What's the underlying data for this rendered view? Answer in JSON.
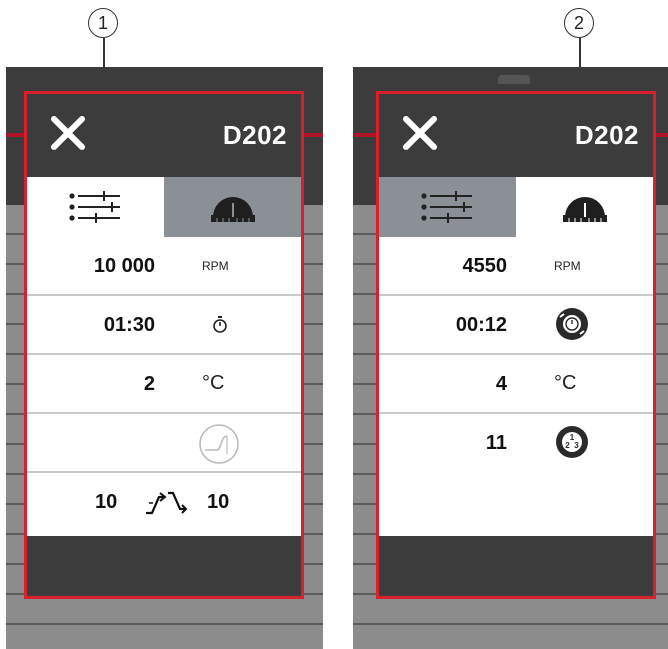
{
  "panels": [
    {
      "callout": "1",
      "title": "D202",
      "active_tab": "settings",
      "rows": [
        {
          "value": "10 000",
          "unit": "RPM"
        },
        {
          "value": "01:30",
          "unit": "timer-icon"
        },
        {
          "value": "2",
          "unit": "°C"
        },
        {
          "value": "",
          "unit": "curve-icon"
        },
        {
          "accel": "10",
          "decel": "10"
        }
      ]
    },
    {
      "callout": "2",
      "title": "D202",
      "active_tab": "status",
      "rows": [
        {
          "value": "4550",
          "unit": "RPM"
        },
        {
          "value": "00:12",
          "unit": "run-time-icon"
        },
        {
          "value": "4",
          "unit": "°C"
        },
        {
          "value": "11",
          "unit": "cycle-count-icon"
        }
      ]
    }
  ],
  "colors": {
    "frame": "#d8202f",
    "header": "#3c3c3c",
    "inactive_tab": "#8a9096"
  }
}
